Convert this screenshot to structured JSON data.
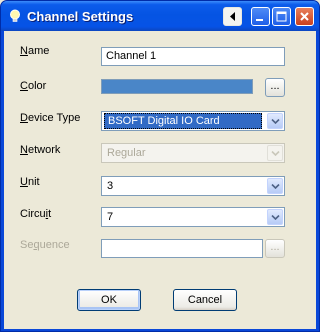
{
  "window": {
    "title": "Channel Settings"
  },
  "fields": {
    "name": {
      "label_pre": "",
      "label_accel": "N",
      "label_post": "ame",
      "value": "Channel 1"
    },
    "color": {
      "label_pre": "",
      "label_accel": "C",
      "label_post": "olor",
      "value_hex": "#4A86C8",
      "button_label": "..."
    },
    "device_type": {
      "label_pre": "",
      "label_accel": "D",
      "label_post": "evice Type",
      "value": "BSOFT Digital IO Card"
    },
    "network": {
      "label_pre": "",
      "label_accel": "N",
      "label_post": "etwork",
      "value": "Regular"
    },
    "unit": {
      "label_pre": "",
      "label_accel": "U",
      "label_post": "nit",
      "value": "3"
    },
    "circuit": {
      "label_pre": "Circu",
      "label_accel": "i",
      "label_post": "t",
      "value": "7"
    },
    "sequence": {
      "label_pre": "Se",
      "label_accel": "q",
      "label_post": "uence",
      "value": "",
      "button_label": "..."
    }
  },
  "buttons": {
    "ok": "OK",
    "cancel": "Cancel"
  },
  "colors": {
    "titlebar": "#0554E3",
    "selection": "#316AC5",
    "disabled_text": "#ACA899"
  }
}
